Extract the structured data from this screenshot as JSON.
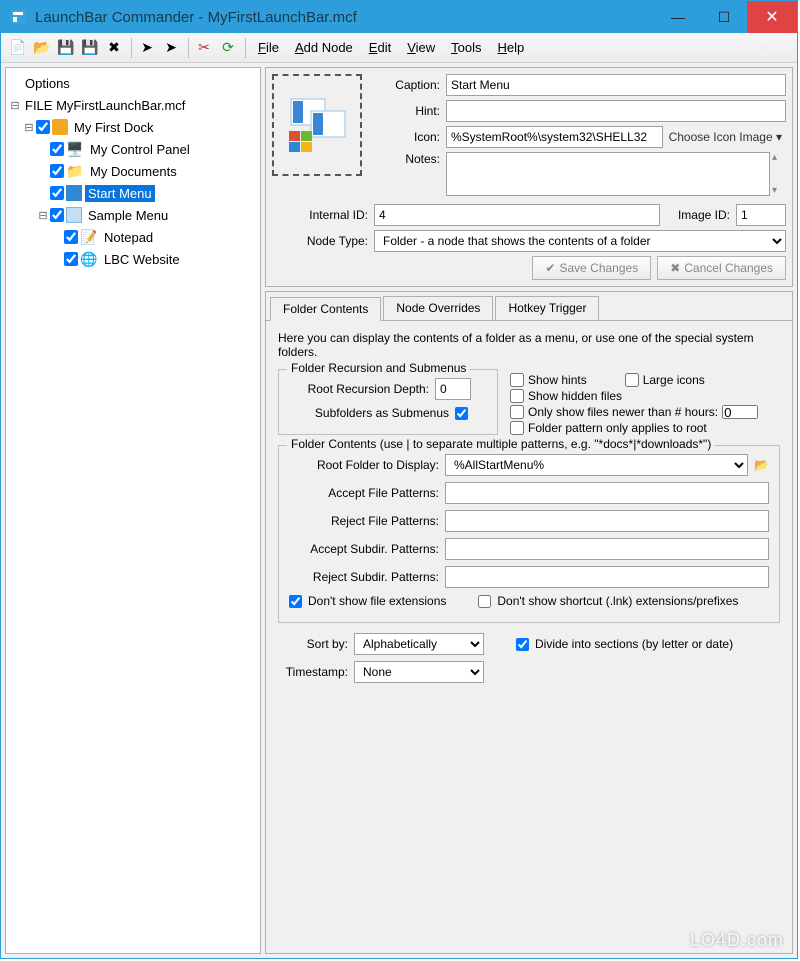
{
  "titlebar": {
    "title": "LaunchBar Commander - MyFirstLaunchBar.mcf"
  },
  "menubar": {
    "file": "File",
    "addnode": "Add Node",
    "edit": "Edit",
    "view": "View",
    "tools": "Tools",
    "help": "Help"
  },
  "tree": {
    "options": "Options",
    "file": "FILE MyFirstLaunchBar.mcf",
    "dock": "My First Dock",
    "items": {
      "control": "My Control Panel",
      "docs": "My Documents",
      "start": "Start Menu",
      "sample": "Sample Menu",
      "notepad": "Notepad",
      "lbc": "LBC Website"
    }
  },
  "form": {
    "caption_label": "Caption:",
    "caption_value": "Start Menu",
    "hint_label": "Hint:",
    "hint_value": "",
    "icon_label": "Icon:",
    "icon_value": "%SystemRoot%\\system32\\SHELL32",
    "choose_icon": "Choose Icon Image",
    "notes_label": "Notes:",
    "notes_value": "",
    "internalid_label": "Internal ID:",
    "internalid_value": "4",
    "imageid_label": "Image ID:",
    "imageid_value": "1",
    "nodetype_label": "Node Type:",
    "nodetype_value": "Folder - a node that shows the contents of a folder",
    "save": "Save Changes",
    "cancel": "Cancel Changes"
  },
  "tabs": {
    "t1": "Folder Contents",
    "t2": "Node Overrides",
    "t3": "Hotkey Trigger"
  },
  "fc": {
    "intro": "Here you can display the contents of a folder as a menu, or use one of the special system folders.",
    "recursion_legend": "Folder Recursion and Submenus",
    "root_recursion": "Root Recursion Depth:",
    "root_recursion_val": "0",
    "subfolders": "Subfolders as Submenus",
    "show_hints": "Show hints",
    "large_icons": "Large icons",
    "show_hidden": "Show hidden files",
    "only_newer": "Only show files newer than # hours:",
    "only_newer_val": "0",
    "pattern_root": "Folder pattern only applies to root",
    "contents_legend": "Folder Contents (use | to separate multiple patterns, e.g. \"*docs*|*downloads*\")",
    "root_folder": "Root Folder to Display:",
    "root_folder_val": "%AllStartMenu%",
    "accept_file": "Accept File Patterns:",
    "reject_file": "Reject File Patterns:",
    "accept_sub": "Accept Subdir. Patterns:",
    "reject_sub": "Reject Subdir. Patterns:",
    "dont_show_ext": "Don't show file extensions",
    "dont_show_lnk": "Don't show shortcut (.lnk) extensions/prefixes",
    "sort_by": "Sort by:",
    "sort_by_val": "Alphabetically",
    "divide": "Divide into sections (by letter or date)",
    "timestamp": "Timestamp:",
    "timestamp_val": "None"
  },
  "watermark": "LO4D.com"
}
